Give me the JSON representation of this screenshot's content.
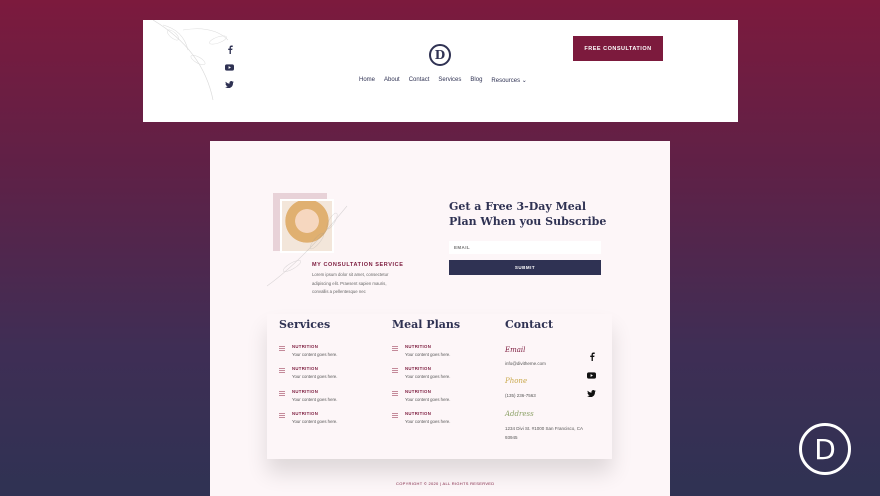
{
  "header": {
    "logo_letter": "D",
    "nav": [
      "Home",
      "About",
      "Contact",
      "Services",
      "Blog",
      "Resources ⌄"
    ],
    "cta_label": "FREE CONSULTATION",
    "social_icons": [
      "facebook-icon",
      "youtube-icon",
      "twitter-icon"
    ]
  },
  "subscribe": {
    "consult_title": "MY CONSULTATION SERVICE",
    "consult_text": "Lorem ipsum dolor sit amet, consectetur adipiscing elit. Praesent sapien mauris, convallis a pellentesque nec",
    "title": "Get a Free 3-Day Meal Plan When you Subscribe",
    "email_placeholder": "EMAIL",
    "submit_label": "SUBMIT"
  },
  "footer": {
    "services_title": "Services",
    "mealplans_title": "Meal Plans",
    "contact_title": "Contact",
    "item_title": "NUTRITION",
    "item_text": "Your content goes here.",
    "email_label": "Email",
    "email_value": "info@divitheme.com",
    "phone_label": "Phone",
    "phone_value": "(135) 236-7563",
    "address_label": "Address",
    "address_value": "1234 Divi St. #1000 San Francisco, CA 93945",
    "copyright": "COPYRIGHT © 2020 | ALL RIGHTS RESERVED"
  },
  "badge": {
    "letter": "D"
  },
  "colors": {
    "brand": "#7c1a3d",
    "navy": "#2f3253"
  }
}
